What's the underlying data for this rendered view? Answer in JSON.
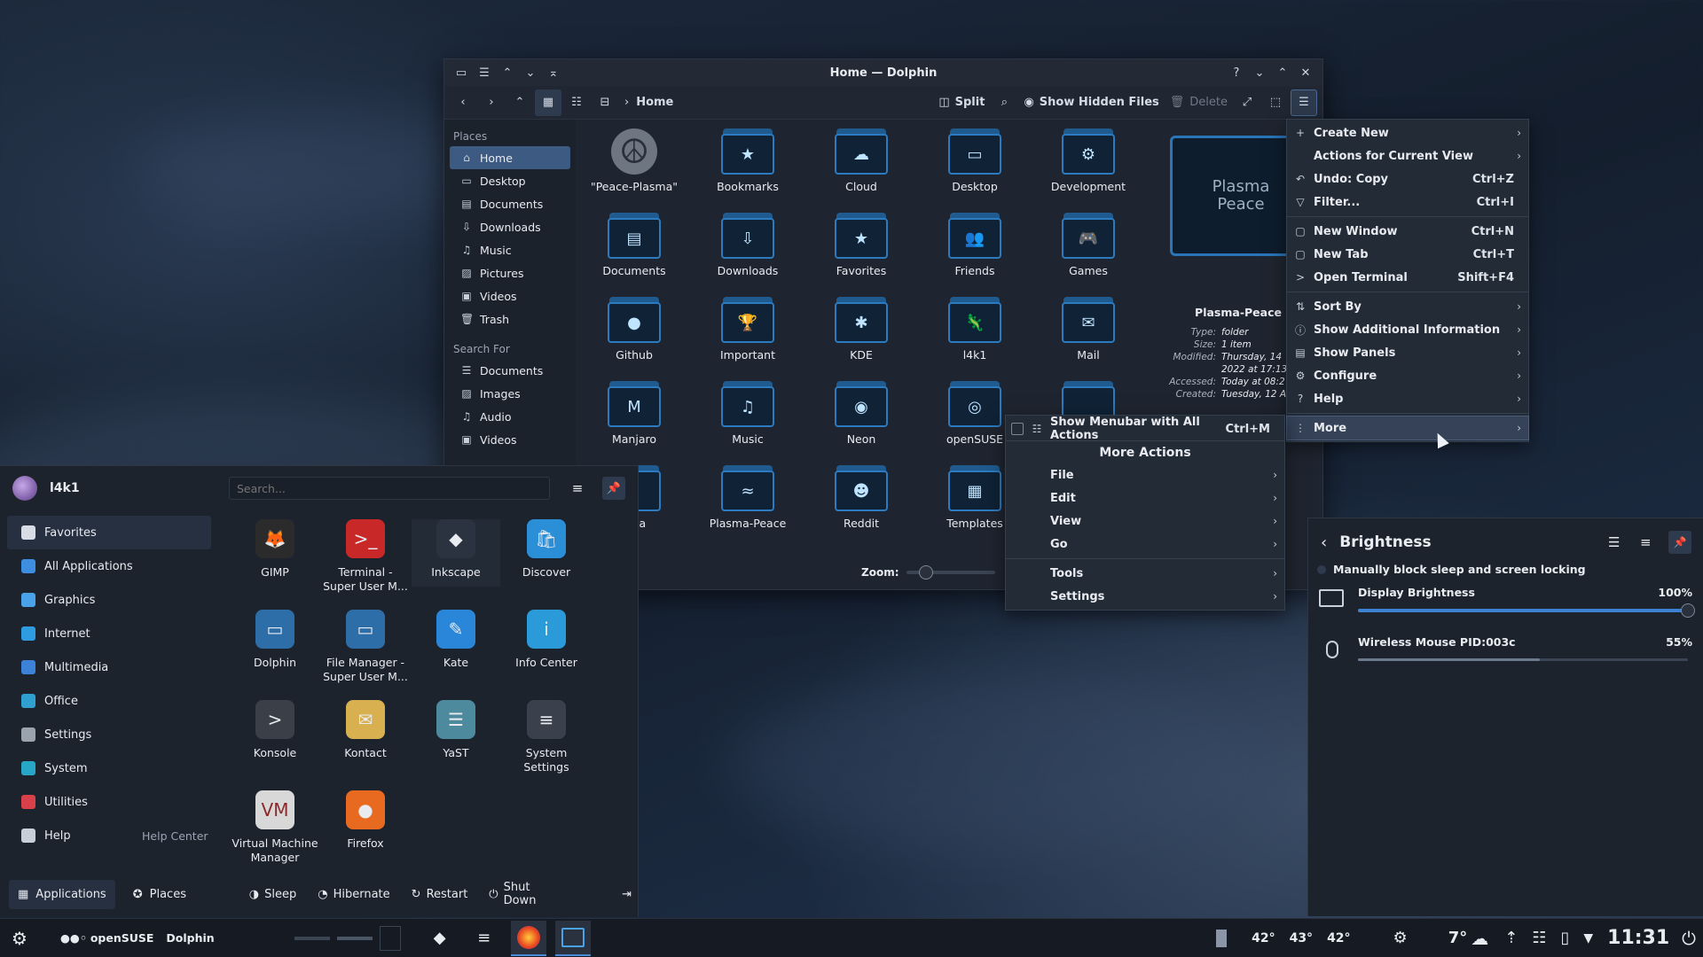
{
  "dolphin": {
    "title": "Home — Dolphin",
    "breadcrumb": "Home",
    "toolbar": {
      "split": "Split",
      "hidden": "Show Hidden Files",
      "delete": "Delete"
    },
    "places_header": "Places",
    "places": [
      "Home",
      "Desktop",
      "Documents",
      "Downloads",
      "Music",
      "Pictures",
      "Videos",
      "Trash"
    ],
    "search_header": "Search For",
    "search": [
      "Documents",
      "Images",
      "Audio",
      "Videos"
    ],
    "files": [
      "\"Peace-Plasma\"",
      "Bookmarks",
      "Cloud",
      "Desktop",
      "Development",
      "Documents",
      "Downloads",
      "Favorites",
      "Friends",
      "Games",
      "Github",
      "Important",
      "KDE",
      "l4k1",
      "Mail",
      "Manjaro",
      "Music",
      "Neon",
      "openSUSE",
      "",
      "sma",
      "Plasma-Peace",
      "Reddit",
      "Templates"
    ],
    "zoom_label": "Zoom:",
    "info": {
      "name": "Plasma-Peace",
      "preview": "Plasma Peace",
      "rows": [
        [
          "Type:",
          "folder"
        ],
        [
          "Size:",
          "1 item"
        ],
        [
          "Modified:",
          "Thursday, 14"
        ],
        [
          "",
          "2022 at 17:13"
        ],
        [
          "Accessed:",
          "Today at 08:2"
        ],
        [
          "Created:",
          "Tuesday, 12 A"
        ]
      ]
    }
  },
  "menu": {
    "items": [
      {
        "icon": "+",
        "label": "Create New",
        "shortcut": "",
        "sub": true
      },
      {
        "icon": "",
        "label": "Actions for Current View",
        "shortcut": "",
        "sub": true
      },
      {
        "icon": "↶",
        "label": "Undo: Copy",
        "shortcut": "Ctrl+Z",
        "sub": false
      },
      {
        "icon": "▽",
        "label": "Filter...",
        "shortcut": "Ctrl+I",
        "sub": false
      },
      {
        "sep": true
      },
      {
        "icon": "▢",
        "label": "New Window",
        "shortcut": "Ctrl+N",
        "sub": false
      },
      {
        "icon": "▢",
        "label": "New Tab",
        "shortcut": "Ctrl+T",
        "sub": false
      },
      {
        "icon": ">",
        "label": "Open Terminal",
        "shortcut": "Shift+F4",
        "sub": false
      },
      {
        "sep": true
      },
      {
        "icon": "⇅",
        "label": "Sort By",
        "shortcut": "",
        "sub": true
      },
      {
        "icon": "ⓘ",
        "label": "Show Additional Information",
        "shortcut": "",
        "sub": true
      },
      {
        "icon": "▤",
        "label": "Show Panels",
        "shortcut": "",
        "sub": true
      },
      {
        "icon": "⚙",
        "label": "Configure",
        "shortcut": "",
        "sub": true
      },
      {
        "icon": "?",
        "label": "Help",
        "shortcut": "",
        "sub": true
      },
      {
        "sep": true
      },
      {
        "icon": "⋮",
        "label": "More",
        "shortcut": "",
        "sub": true,
        "hl": true
      }
    ]
  },
  "more_menu": {
    "menubar_label": "Show Menubar with All Actions",
    "menubar_shortcut": "Ctrl+M",
    "header": "More Actions",
    "items": [
      "File",
      "Edit",
      "View",
      "Go"
    ],
    "items2": [
      "Tools",
      "Settings"
    ]
  },
  "kickoff": {
    "user": "l4k1",
    "search_placeholder": "Search...",
    "categories": [
      {
        "label": "Favorites",
        "color": "#d8dde5"
      },
      {
        "label": "All Applications",
        "color": "#3d8ee0"
      },
      {
        "label": "Graphics",
        "color": "#4aa3e8"
      },
      {
        "label": "Internet",
        "color": "#2f9be0"
      },
      {
        "label": "Multimedia",
        "color": "#3b82d8"
      },
      {
        "label": "Office",
        "color": "#2fa0d0"
      },
      {
        "label": "Settings",
        "color": "#9aa3ae"
      },
      {
        "label": "System",
        "color": "#27a6c8"
      },
      {
        "label": "Utilities",
        "color": "#d8414a"
      },
      {
        "label": "Help",
        "color": "#c9cfd8"
      }
    ],
    "help_center": "Help Center",
    "apps": [
      {
        "l1": "GIMP",
        "l2": "",
        "icon": "🦊",
        "bg": "#2b2b2b"
      },
      {
        "l1": "Terminal -",
        "l2": "Super User M...",
        "icon": ">_",
        "bg": "#c82828"
      },
      {
        "l1": "Inkscape",
        "l2": "",
        "icon": "◆",
        "bg": "#2b3340"
      },
      {
        "l1": "Discover",
        "l2": "",
        "icon": "🛍",
        "bg": "#2b8fd8"
      },
      {
        "l1": "Dolphin",
        "l2": "",
        "icon": "▭",
        "bg": "#2e6ea8"
      },
      {
        "l1": "File Manager -",
        "l2": "Super User M...",
        "icon": "▭",
        "bg": "#2e6ea8"
      },
      {
        "l1": "Kate",
        "l2": "",
        "icon": "✎",
        "bg": "#2a86d8"
      },
      {
        "l1": "Info Center",
        "l2": "",
        "icon": "i",
        "bg": "#2a9ad8"
      },
      {
        "l1": "Konsole",
        "l2": "",
        "icon": ">",
        "bg": "#3a3f48"
      },
      {
        "l1": "Kontact",
        "l2": "",
        "icon": "✉",
        "bg": "#d8b050"
      },
      {
        "l1": "YaST",
        "l2": "",
        "icon": "☰",
        "bg": "#4e8a9e"
      },
      {
        "l1": "System Settings",
        "l2": "",
        "icon": "≡",
        "bg": "#3a414c"
      },
      {
        "l1": "Virtual Machine",
        "l2": "Manager",
        "icon": "VM",
        "bg": "#d8d8d8"
      },
      {
        "l1": "Firefox",
        "l2": "",
        "icon": "●",
        "bg": "#e86a20"
      }
    ],
    "footer": {
      "apps": "Applications",
      "places": "Places",
      "sleep": "Sleep",
      "hibernate": "Hibernate",
      "restart": "Restart",
      "shutdown": "Shut Down"
    }
  },
  "brightness": {
    "title": "Brightness",
    "block": "Manually block sleep and screen locking",
    "display": "Display Brightness",
    "display_val": "100%",
    "display_level": 1.0,
    "mouse": "Wireless Mouse PID:003c",
    "mouse_val": "55%",
    "mouse_level": 0.55
  },
  "taskbar": {
    "desktop_label": "openSUSE",
    "active": "Dolphin",
    "temps": [
      "42°",
      "43°",
      "42°"
    ],
    "weather": "7°",
    "clock": "11:31"
  }
}
